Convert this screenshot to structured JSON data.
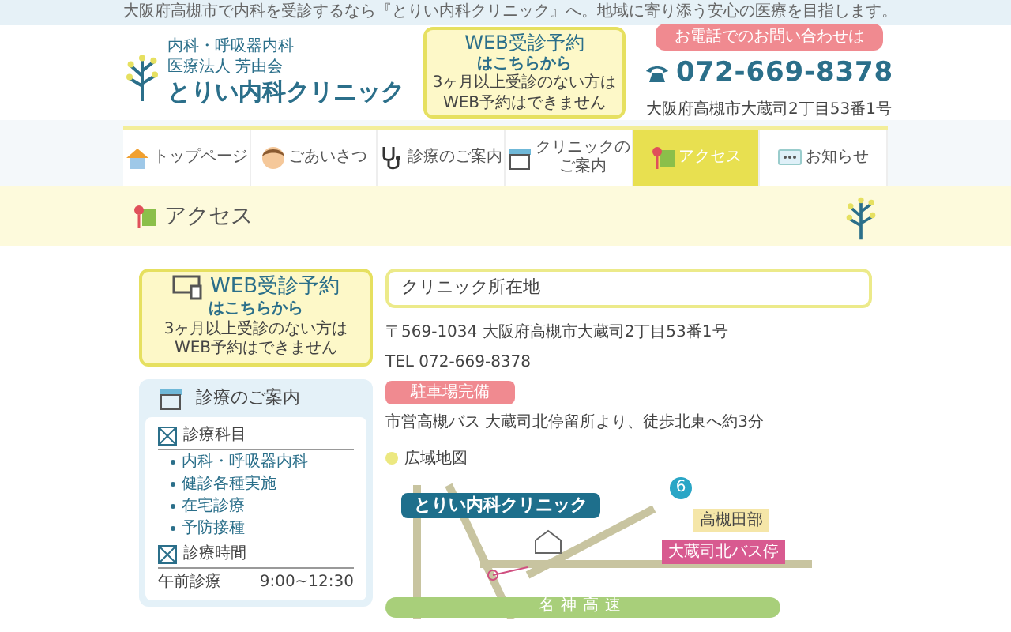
{
  "tagline": "大阪府高槻市で内科を受診するなら『とりい内科クリニック』へ。地域に寄り添う安心の医療を目指します。",
  "logo": {
    "line1": "内科・呼吸器内科",
    "line2": "医療法人 芳由会",
    "name": "とりい内科クリニック"
  },
  "web_booking": {
    "title": "WEB受診予約",
    "link": "はこちらから",
    "note1": "3ヶ月以上受診のない方は",
    "note2": "WEB予約はできません"
  },
  "contact": {
    "label": "お電話でのお問い合わせは",
    "phone": "072-669-8378",
    "address": "大阪府高槻市大蔵司2丁目53番1号"
  },
  "nav": [
    {
      "label": "トップページ",
      "kind": "house",
      "selected": false
    },
    {
      "label": "ごあいさつ",
      "kind": "doctor",
      "selected": false
    },
    {
      "label": "診療のご案内",
      "kind": "stethoscope",
      "selected": false
    },
    {
      "label": "クリニックのご案内",
      "kind": "clinic",
      "selected": false
    },
    {
      "label": "アクセス",
      "kind": "pin",
      "selected": true
    },
    {
      "label": "お知らせ",
      "kind": "chat",
      "selected": false
    }
  ],
  "page_title": "アクセス",
  "side_booking": {
    "title": "WEB受診予約",
    "link": "はこちらから",
    "note": "3ヶ月以上受診のない方はWEB予約はできません"
  },
  "side_panel": {
    "title": "診療のご案内",
    "sections": [
      {
        "heading": "診療科目",
        "items": [
          "内科・呼吸器内科",
          "健診各種実施",
          "在宅診療",
          "予防接種"
        ]
      },
      {
        "heading": "診療時間",
        "rows": [
          {
            "label": "午前診療",
            "time": "9:00~12:30"
          }
        ]
      }
    ]
  },
  "location": {
    "heading": "クリニック所在地",
    "address": "〒569-1034 大阪府高槻市大蔵司2丁目53番1号",
    "tel": "TEL 072-669-8378",
    "parking": "駐車場完備",
    "bus": "市営高槻バス 大蔵司北停留所より、徒歩北東へ約3分"
  },
  "map": {
    "legend": "広域地図",
    "clinic": "とりい内科クリニック",
    "route_number": "6",
    "school": "高槻田部",
    "bus_stop": "大蔵司北バス停",
    "highway": "名神高速"
  }
}
